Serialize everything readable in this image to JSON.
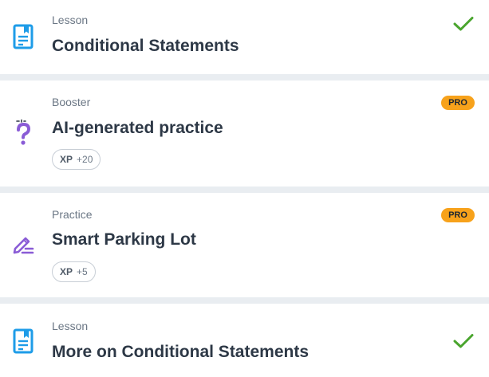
{
  "items": [
    {
      "type": "Lesson",
      "title": "Conditional Statements",
      "icon": "lesson-book-icon",
      "completed": true
    },
    {
      "type": "Booster",
      "title": "AI-generated practice",
      "icon": "question-sparkle-icon",
      "badge": "PRO",
      "xp_label": "XP",
      "xp_value": "+20"
    },
    {
      "type": "Practice",
      "title": "Smart Parking Lot",
      "icon": "pencil-edit-icon",
      "badge": "PRO",
      "xp_label": "XP",
      "xp_value": "+5"
    },
    {
      "type": "Lesson",
      "title": "More on Conditional Statements",
      "icon": "lesson-book-icon",
      "completed": true
    }
  ],
  "colors": {
    "lesson_icon": "#1e9ce8",
    "practice_icon": "#8a5cd6",
    "check": "#4aa52e",
    "pro_badge": "#f7a21b",
    "background": "#e9edf1"
  }
}
